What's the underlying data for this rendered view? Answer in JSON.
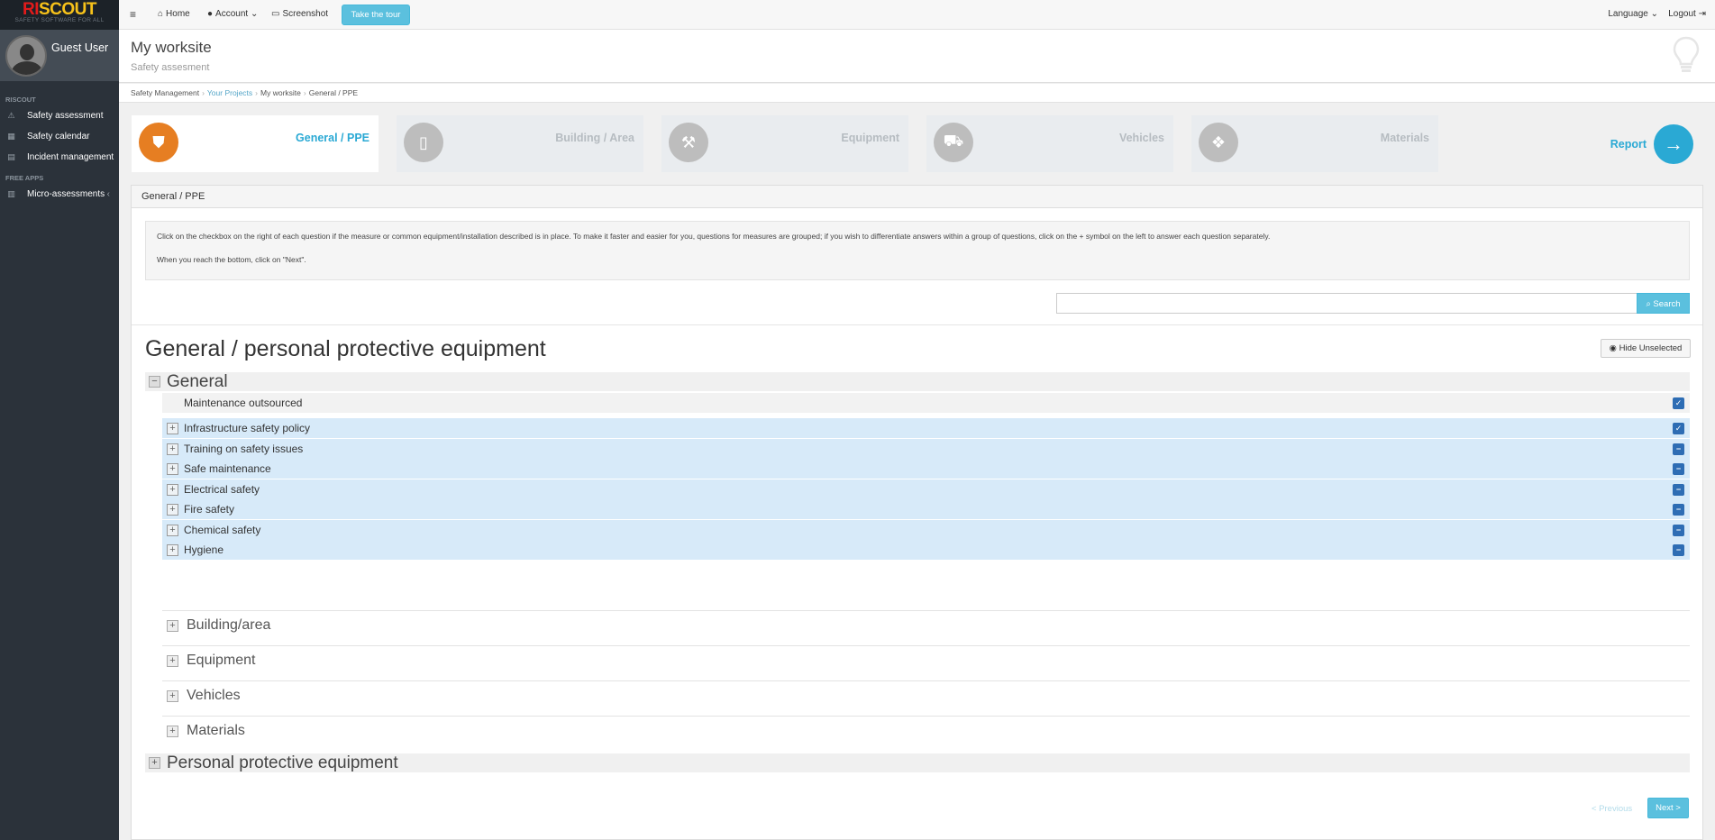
{
  "brand": {
    "logo_part1": "RI",
    "logo_part2": "SCOUT",
    "tagline": "SAFETY SOFTWARE FOR ALL"
  },
  "user": {
    "name": "Guest User"
  },
  "sidebar": {
    "section1_header": "RISCOUT",
    "items": [
      {
        "label": "Safety assessment",
        "icon": "warning-icon"
      },
      {
        "label": "Safety calendar",
        "icon": "calendar-icon"
      },
      {
        "label": "Incident management",
        "icon": "document-icon"
      }
    ],
    "section2_header": "FREE APPS",
    "apps": [
      {
        "label": "Micro-assessments",
        "icon": "clipboard-icon"
      }
    ]
  },
  "topbar": {
    "menu_icon": "menu-icon",
    "home": "Home",
    "account": "Account",
    "screenshot": "Screenshot",
    "tour": "Take the tour",
    "language": "Language",
    "logout": "Logout"
  },
  "header": {
    "title": "My worksite",
    "subtitle": "Safety assesment"
  },
  "breadcrumb": [
    "Safety Management",
    "Your Projects",
    "My worksite",
    "General / PPE"
  ],
  "steps": [
    {
      "label": "General / PPE",
      "icon": "shield-icon",
      "active": true
    },
    {
      "label": "Building / Area",
      "icon": "building-icon",
      "active": false
    },
    {
      "label": "Equipment",
      "icon": "wrench-icon",
      "active": false
    },
    {
      "label": "Vehicles",
      "icon": "truck-icon",
      "active": false
    },
    {
      "label": "Materials",
      "icon": "cubes-icon",
      "active": false
    }
  ],
  "report": {
    "label": "Report"
  },
  "panel": {
    "heading": "General / PPE",
    "instruction1": "Click on the checkbox on the right of each question if the measure or common equipment/installation described is in place. To make it faster and easier for you, questions for measures are grouped; if you wish to differentiate answers within a group of questions, click on the + symbol on the left to answer each question separately.",
    "instruction2": "When you reach the bottom, click on \"Next\".",
    "search_button": "Search",
    "search_placeholder": "",
    "form_title": "General / personal protective equipment",
    "hide_button": "Hide Unselected",
    "section_general": "General",
    "rows": [
      {
        "label": "Maintenance outsourced",
        "state": "checked"
      },
      {
        "label": "Infrastructure safety policy",
        "state": "checked"
      },
      {
        "label": "Training on safety issues",
        "state": "partial"
      },
      {
        "label": "Safe maintenance",
        "state": "partial"
      },
      {
        "label": "Electrical safety",
        "state": "partial"
      },
      {
        "label": "Fire safety",
        "state": "partial"
      },
      {
        "label": "Chemical safety",
        "state": "partial"
      },
      {
        "label": "Hygiene",
        "state": "partial"
      }
    ],
    "subsections": [
      "Building/area",
      "Equipment",
      "Vehicles",
      "Materials"
    ],
    "section_ppe": "Personal protective equipment",
    "prev": "< Previous",
    "next": "Next >"
  }
}
